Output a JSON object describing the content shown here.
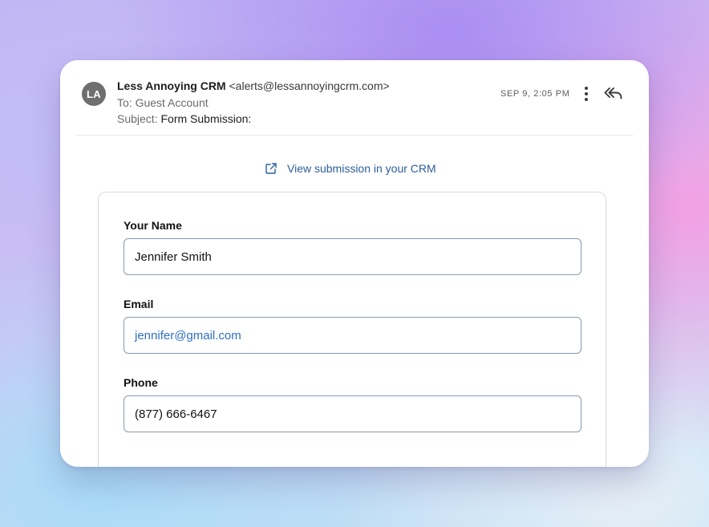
{
  "email": {
    "avatar_initials": "LA",
    "from_name": "Less Annoying CRM",
    "from_email": "<alerts@lessannoyingcrm.com>",
    "to_label": "To:",
    "to_value": "Guest Account",
    "subject_label": "Subject:",
    "subject_value": "Form Submission:",
    "date": "SEP 9, 2:05 PM",
    "more_icon": "vertical-ellipsis-icon",
    "reply_icon": "reply-all-icon"
  },
  "body": {
    "view_link_icon": "external-link-icon",
    "view_link_label": "View submission in your CRM",
    "link_color": "#2c5e9b",
    "fields": [
      {
        "label": "Your Name",
        "value": "Jennifer Smith"
      },
      {
        "label": "Email",
        "value": "jennifer@gmail.com"
      },
      {
        "label": "Phone",
        "value": "(877) 666-6467"
      }
    ]
  }
}
